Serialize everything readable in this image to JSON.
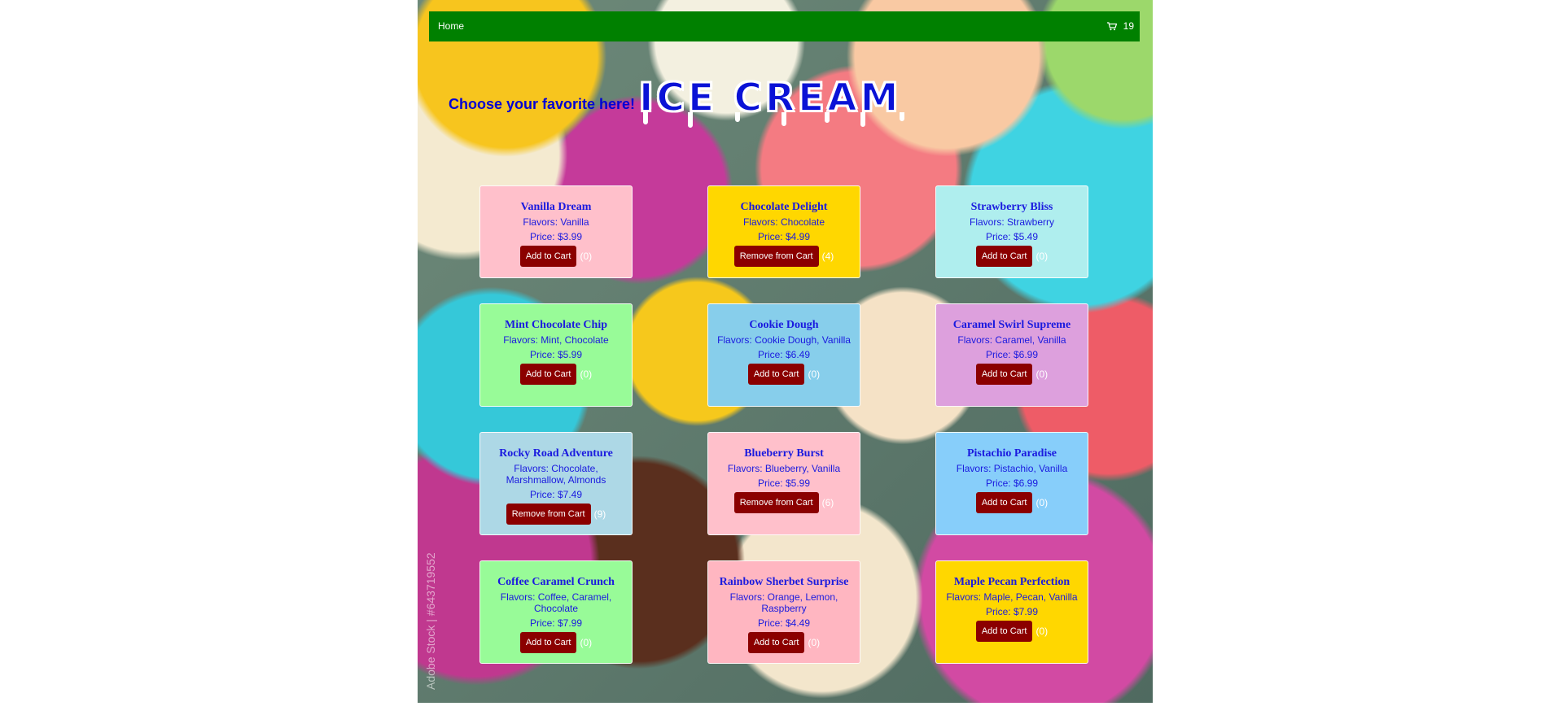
{
  "nav": {
    "home_label": "Home",
    "cart_count": "19",
    "cart_icon": "cart-icon"
  },
  "header": {
    "tagline": "Choose your favorite here!",
    "brand": "ICE CREAM"
  },
  "watermark": "Adobe Stock | #643719552",
  "colors": {
    "navbar": "#008000",
    "button": "#8b0000",
    "text": "#1a1adf"
  },
  "products": [
    {
      "name": "Vanilla Dream",
      "flavors": "Flavors: Vanilla",
      "price": "Price: $3.99",
      "button": "Add to Cart",
      "count": "(0)",
      "bg": "#ffc0cb"
    },
    {
      "name": "Chocolate Delight",
      "flavors": "Flavors: Chocolate",
      "price": "Price: $4.99",
      "button": "Remove from Cart",
      "count": "(4)",
      "bg": "#ffd700"
    },
    {
      "name": "Strawberry Bliss",
      "flavors": "Flavors: Strawberry",
      "price": "Price: $5.49",
      "button": "Add to Cart",
      "count": "(0)",
      "bg": "#afeeee"
    },
    {
      "name": "Mint Chocolate Chip",
      "flavors": "Flavors: Mint, Chocolate",
      "price": "Price: $5.99",
      "button": "Add to Cart",
      "count": "(0)",
      "bg": "#98fb98"
    },
    {
      "name": "Cookie Dough",
      "flavors": "Flavors: Cookie Dough, Vanilla",
      "price": "Price: $6.49",
      "button": "Add to Cart",
      "count": "(0)",
      "bg": "#87ceeb"
    },
    {
      "name": "Caramel Swirl Supreme",
      "flavors": "Flavors: Caramel, Vanilla",
      "price": "Price: $6.99",
      "button": "Add to Cart",
      "count": "(0)",
      "bg": "#dda0dd"
    },
    {
      "name": "Rocky Road Adventure",
      "flavors": "Flavors: Chocolate, Marshmallow, Almonds",
      "price": "Price: $7.49",
      "button": "Remove from Cart",
      "count": "(9)",
      "bg": "#add8e6"
    },
    {
      "name": "Blueberry Burst",
      "flavors": "Flavors: Blueberry, Vanilla",
      "price": "Price: $5.99",
      "button": "Remove from Cart",
      "count": "(6)",
      "bg": "#ffc0cb"
    },
    {
      "name": "Pistachio Paradise",
      "flavors": "Flavors: Pistachio, Vanilla",
      "price": "Price: $6.99",
      "button": "Add to Cart",
      "count": "(0)",
      "bg": "#87cefa"
    },
    {
      "name": "Coffee Caramel Crunch",
      "flavors": "Flavors: Coffee, Caramel, Chocolate",
      "price": "Price: $7.99",
      "button": "Add to Cart",
      "count": "(0)",
      "bg": "#98fb98"
    },
    {
      "name": "Rainbow Sherbet Surprise",
      "flavors": "Flavors: Orange, Lemon, Raspberry",
      "price": "Price: $4.49",
      "button": "Add to Cart",
      "count": "(0)",
      "bg": "#ffb6c1"
    },
    {
      "name": "Maple Pecan Perfection",
      "flavors": "Flavors: Maple, Pecan, Vanilla",
      "price": "Price: $7.99",
      "button": "Add to Cart",
      "count": "(0)",
      "bg": "#ffd700"
    }
  ]
}
